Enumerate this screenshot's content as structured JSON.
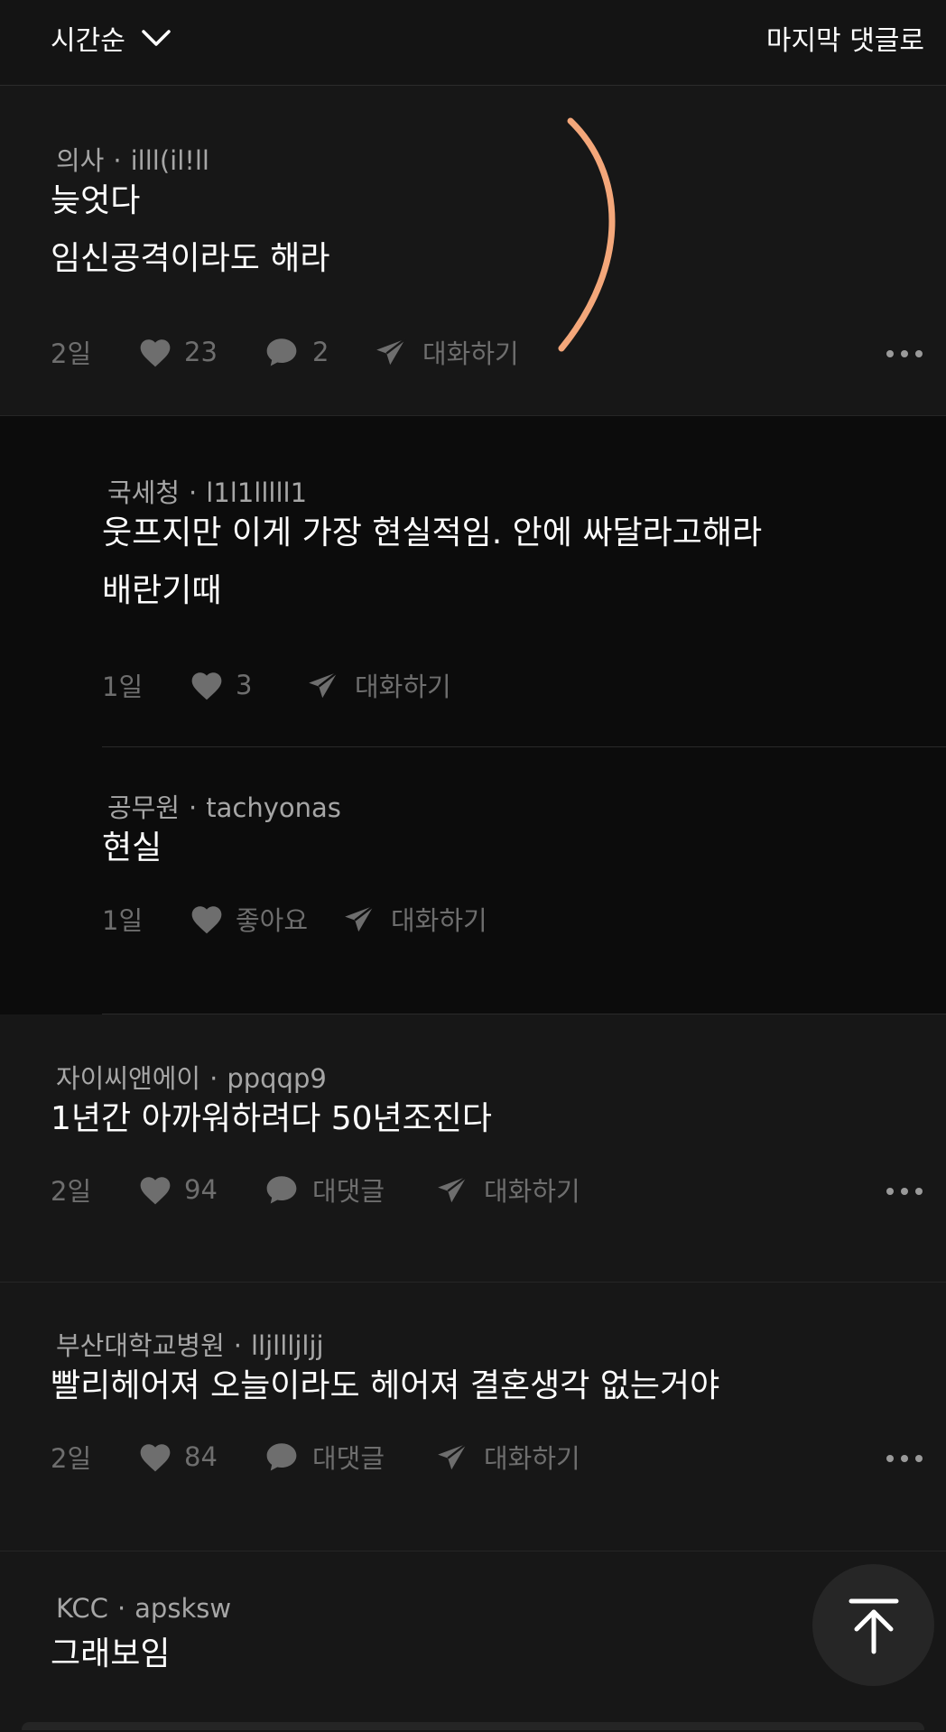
{
  "topbar": {
    "sort_label": "시간순",
    "jump_label": "마지막 댓글로"
  },
  "icons": {
    "heart": "heart-icon",
    "comment": "comment-icon",
    "send": "send-icon",
    "more": "more-icon",
    "chevron": "chevron-down-icon",
    "scroll_top": "arrow-up-icon"
  },
  "colors": {
    "background": "#141414",
    "reply_background": "#0c0c0c",
    "accent_arc": "#f4a77a",
    "muted": "#6e6e6e"
  },
  "comments": [
    {
      "job": "의사",
      "user": "illl(il!ll",
      "lines": [
        "늦엇다",
        "임신공격이라도 해라"
      ],
      "time": "2일",
      "likes": "23",
      "replies": "2",
      "chat": "대화하기"
    },
    {
      "job": "국세청",
      "user": "l1l1lllll1",
      "lines": [
        "웃프지만 이게 가장 현실적임. 안에 싸달라고해라",
        "배란기때"
      ],
      "time": "1일",
      "likes": "3",
      "chat": "대화하기"
    },
    {
      "job": "공무원",
      "user": "tachyonas",
      "lines": [
        "현실"
      ],
      "time": "1일",
      "likes": "좋아요",
      "chat": "대화하기"
    },
    {
      "job": "자이씨앤에이",
      "user": "ppqqp9",
      "lines": [
        "1년간 아까워하려다 50년조진다"
      ],
      "time": "2일",
      "likes": "94",
      "replies": "대댓글",
      "chat": "대화하기"
    },
    {
      "job": "부산대학교병원",
      "user": "lljllljljj",
      "lines": [
        "빨리헤어져 오늘이라도 헤어져 결혼생각 없는거야"
      ],
      "time": "2일",
      "likes": "84",
      "replies": "대댓글",
      "chat": "대화하기"
    },
    {
      "job": "KCC",
      "user": "apsksw",
      "lines": [
        "그래보임"
      ]
    }
  ]
}
